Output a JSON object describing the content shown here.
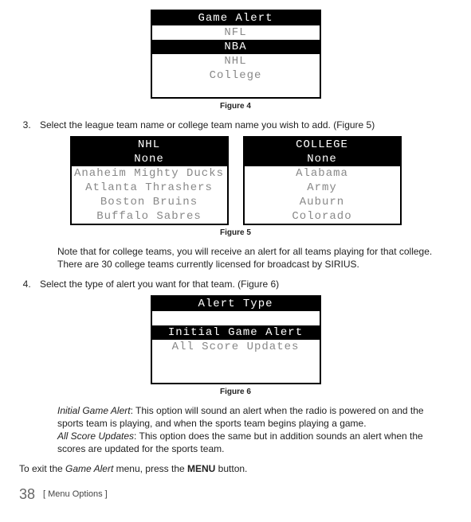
{
  "figure4": {
    "title": "Game Alert",
    "items": [
      "NFL",
      "NBA",
      "NHL",
      "College"
    ],
    "selected_index": 1,
    "caption": "Figure 4"
  },
  "step3": {
    "text": "Select the league team name or college team name you wish to add. (Figure 5)"
  },
  "figure5": {
    "left": {
      "title": "NHL",
      "items": [
        "None",
        "Anaheim Mighty Ducks",
        "Atlanta Thrashers",
        "Boston Bruins",
        "Buffalo Sabres"
      ],
      "selected_index": 0
    },
    "right": {
      "title": "COLLEGE",
      "items": [
        "None",
        "Alabama",
        "Army",
        "Auburn",
        "Colorado"
      ],
      "selected_index": 0
    },
    "caption": "Figure 5"
  },
  "note_college": "Note that for college teams, you will receive an alert for all teams playing for that college. There are 30 college teams currently licensed for broadcast by SIRIUS.",
  "step4": {
    "text": "Select the type of alert you want for that team. (Figure 6)"
  },
  "figure6": {
    "title": "Alert Type",
    "items": [
      "Initial Game Alert",
      "All Score Updates"
    ],
    "selected_index": 0,
    "caption": "Figure 6"
  },
  "explain": {
    "iga_label": "Initial Game Alert",
    "iga_text": ": This option will sound an alert when the radio is powered on and the sports team is playing, and when the sports team begins playing a game.",
    "asu_label": "All Score Updates",
    "asu_text": ": This option does the same but in addition sounds an alert when the scores are updated for the sports team."
  },
  "exit": {
    "pre": "To exit the ",
    "menu_label": "Game Alert",
    "mid": " menu, press the ",
    "button": "MENU",
    "post": " button."
  },
  "footer": {
    "page": "38",
    "section": "[ Menu Options ]"
  }
}
